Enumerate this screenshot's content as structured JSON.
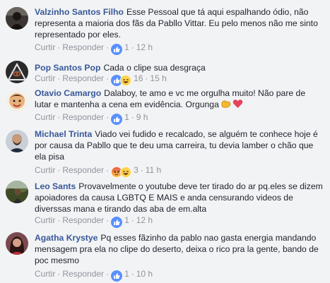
{
  "actions": {
    "like": "Curtir",
    "reply": "Responder",
    "dot": "·"
  },
  "comments": [
    {
      "author": "Valzinho Santos Filho",
      "text": "Esse Pessoal que tá aqui espalhando ódio, não representa a maioria dos fãs da Pabllo Vittar. Eu pelo menos não me sinto representado por eles.",
      "reaction_count": "1",
      "time": "12 h",
      "reactions": [
        "like"
      ],
      "avatar": "avatar-dark-person"
    },
    {
      "author": "Pop Santos Pop",
      "text": "Cada o clipe sua desgraça",
      "reaction_count": "16",
      "time": "15 h",
      "reactions": [
        "like",
        "haha"
      ],
      "avatar": "avatar-illuminati-pyramid"
    },
    {
      "author": "Otavio Camargo",
      "text": "Dalaboy, te amo e vc me orgulha muito! Não pare de lutar e mantenha a cena em evidência. Orgunga",
      "text_emojis": [
        "flexed-biceps-emoji",
        "red-heart-emoji"
      ],
      "reaction_count": "1",
      "time": "9 h",
      "reactions": [
        "like"
      ],
      "avatar": "avatar-cartoon-face"
    },
    {
      "author": "Michael Trinta",
      "text": "Viado vei fudido e recalcado, se alguém te conhece hoje é por causa da Pabllo que te deu uma carreira, tu devia lamber o chão que ela pisa",
      "reaction_count": "3",
      "time": "11 h",
      "reactions": [
        "angry",
        "haha"
      ],
      "avatar": "avatar-bearded-man"
    },
    {
      "author": "Leo Sants",
      "text": "Provavelmente o youtube deve ter tirado do ar pq.eles se dizem apoiadores da causa LGBTQ E MAIS e anda censurando videos de diverssas mana e tirando das aba de em.alta",
      "reaction_count": "1",
      "time": "12 h",
      "reactions": [
        "like"
      ],
      "avatar": "avatar-outdoor-photo"
    },
    {
      "author": "Agatha Krystye",
      "text": "Pq esses fãzinho da pablo nao gasta energia mandando mensagem pra ela no clipe do deserto, deixa o rico pra la gente, bando de poc mesmo",
      "reaction_count": "1",
      "time": "10 h",
      "reactions": [
        "like"
      ],
      "avatar": "avatar-woman-red"
    }
  ]
}
